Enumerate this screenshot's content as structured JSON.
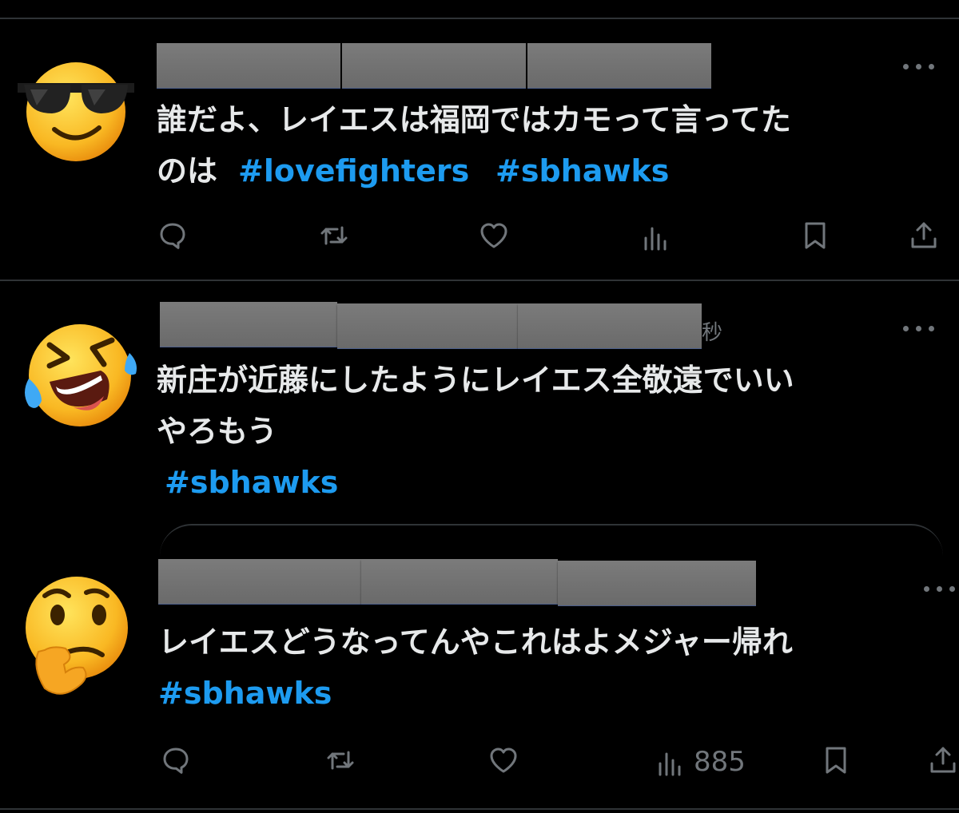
{
  "tweets": [
    {
      "time_fragment": "",
      "text_line1": "誰だよ、レイエスは福岡ではカモって言ってた",
      "text_line2_prefix": "のは",
      "tags": [
        "#lovefighters",
        "#sbhawks"
      ],
      "views": ""
    },
    {
      "time_fragment": "秒",
      "text_line1": "新庄が近藤にしたようにレイエス全敬遠でいい",
      "text_line2_prefix": "やろもう",
      "tags": [
        "#sbhawks"
      ],
      "views": ""
    },
    {
      "time_fragment": "",
      "text_line1": "レイエスどうなってんやこれはよメジャー帰れ",
      "text_line2_prefix": "",
      "tags": [
        "#sbhawks"
      ],
      "views": "885"
    }
  ],
  "icons": {
    "avatar_1": "sunglasses-face-emoji",
    "avatar_2": "rolling-laughing-emoji",
    "avatar_3": "thinking-face-emoji",
    "actions": [
      "reply-icon",
      "retweet-icon",
      "like-icon",
      "views-icon",
      "bookmark-icon",
      "share-icon"
    ]
  },
  "colors": {
    "background": "#000000",
    "text": "#e7e9ea",
    "hashtag": "#1d9bf0",
    "muted": "#71767b",
    "divider": "#2f3336"
  }
}
